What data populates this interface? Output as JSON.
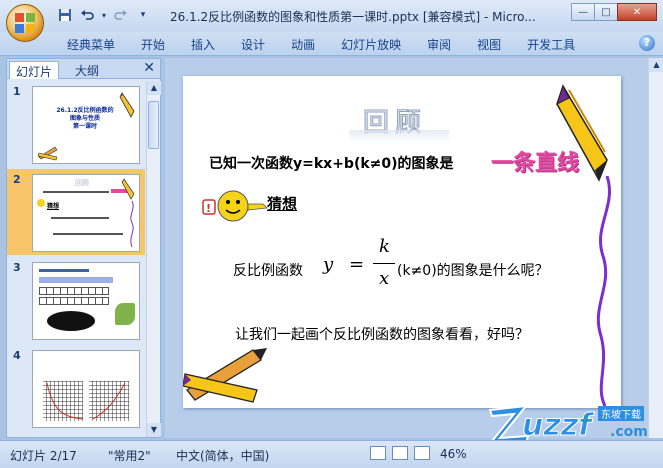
{
  "window": {
    "title": "26.1.2反比例函数的图象和性质第一课时.pptx [兼容模式] - Micro...",
    "controls": [
      "—",
      "□",
      "✕"
    ]
  },
  "quick_access": [
    "save-icon",
    "undo-icon",
    "redo-icon",
    "customize-icon"
  ],
  "ribbon": {
    "tabs": [
      "经典菜单",
      "开始",
      "插入",
      "设计",
      "动画",
      "幻灯片放映",
      "审阅",
      "视图",
      "开发工具"
    ],
    "help": "?"
  },
  "left_pane": {
    "tabs": [
      "幻灯片",
      "大纲"
    ],
    "close": "✕",
    "slides": [
      {
        "num": "1",
        "title_lines": [
          "26.1.2反比例函数的",
          "图象与性质",
          "第一课时"
        ]
      },
      {
        "num": "2",
        "title_lines": [
          "回顾",
          "猜想"
        ]
      },
      {
        "num": "3",
        "title_lines": []
      },
      {
        "num": "4",
        "title_lines": []
      }
    ]
  },
  "slide": {
    "heading": "回顾",
    "line1": "已知一次函数y=kx+b(k≠0)的图象是",
    "answer": "一条直线",
    "guess_label": "猜想",
    "q_prefix": "反比例函数",
    "formula_y": "y",
    "formula_eq": "=",
    "formula_num": "k",
    "formula_den": "x",
    "q_suffix": "(k≠0)的图象是什么呢？",
    "line3": "让我们一起画个反比例函数的图象看看，好吗？"
  },
  "status": {
    "slide_pos": "幻灯片 2/17",
    "theme": "\"常用2\"",
    "language": "中文(简体，中国)",
    "zoom": "46%"
  },
  "watermark": {
    "brand": "uzzf",
    "sub": "东坡下载",
    "url": ".com"
  },
  "colors": {
    "accent": "#15428b",
    "selected_thumb": "#f7c66a",
    "answer_pink": "#e04aa0",
    "purple": "#7b2fd0"
  }
}
